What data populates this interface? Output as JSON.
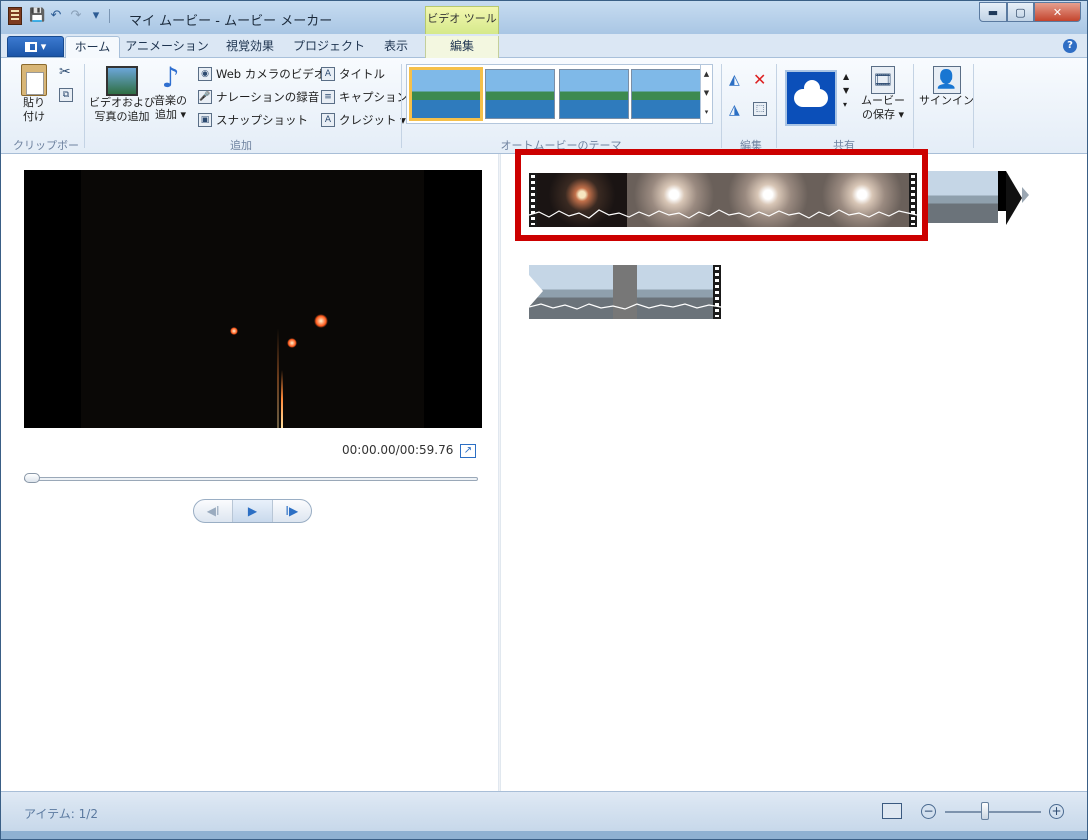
{
  "window": {
    "title": "マイ ムービー - ムービー メーカー",
    "context_tab_group": "ビデオ ツール",
    "buttons": {
      "minimize": "▬",
      "maximize": "▢",
      "close": "✕"
    }
  },
  "quick_access": {
    "save": "💾",
    "undo": "↶",
    "redo": "↷",
    "customize": "▾"
  },
  "tabs": {
    "file": "▤ ▾",
    "items": [
      "ホーム",
      "アニメーション",
      "視覚効果",
      "プロジェクト",
      "表示",
      "編集"
    ],
    "active": "ホーム",
    "help": "?"
  },
  "ribbon": {
    "clipboard": {
      "paste": "貼り付け",
      "paste_line1": "貼り",
      "paste_line2": "付け",
      "label": "クリップボード"
    },
    "add": {
      "video_photo_line1": "ビデオおよび",
      "video_photo_line2": "写真の追加",
      "music_line1": "音楽の",
      "music_line2": "追加 ▾",
      "webcam": "Web カメラのビデオ",
      "narration": "ナレーションの録音 ▾",
      "snapshot": "スナップショット",
      "title": "タイトル",
      "caption": "キャプション",
      "credits": "クレジット ▾",
      "label": "追加"
    },
    "themes": {
      "label": "オートムービーのテーマ"
    },
    "edit": {
      "label": "編集"
    },
    "share": {
      "save_movie_line1": "ムービー",
      "save_movie_line2": "の保存 ▾",
      "label": "共有"
    },
    "signin": "サインイン"
  },
  "preview": {
    "time": "00:00.00/00:59.76",
    "seek_fraction": 0.0,
    "controls": {
      "prev": "◀Ⅰ",
      "play": "▶",
      "next": "Ⅰ▶"
    }
  },
  "status": {
    "items": "アイテム: 1/2",
    "zoom_out": "−",
    "zoom_in": "+"
  },
  "colors": {
    "accent": "#1b55a8",
    "highlight": "#cc0000",
    "context_tab": "#d5e98b"
  }
}
